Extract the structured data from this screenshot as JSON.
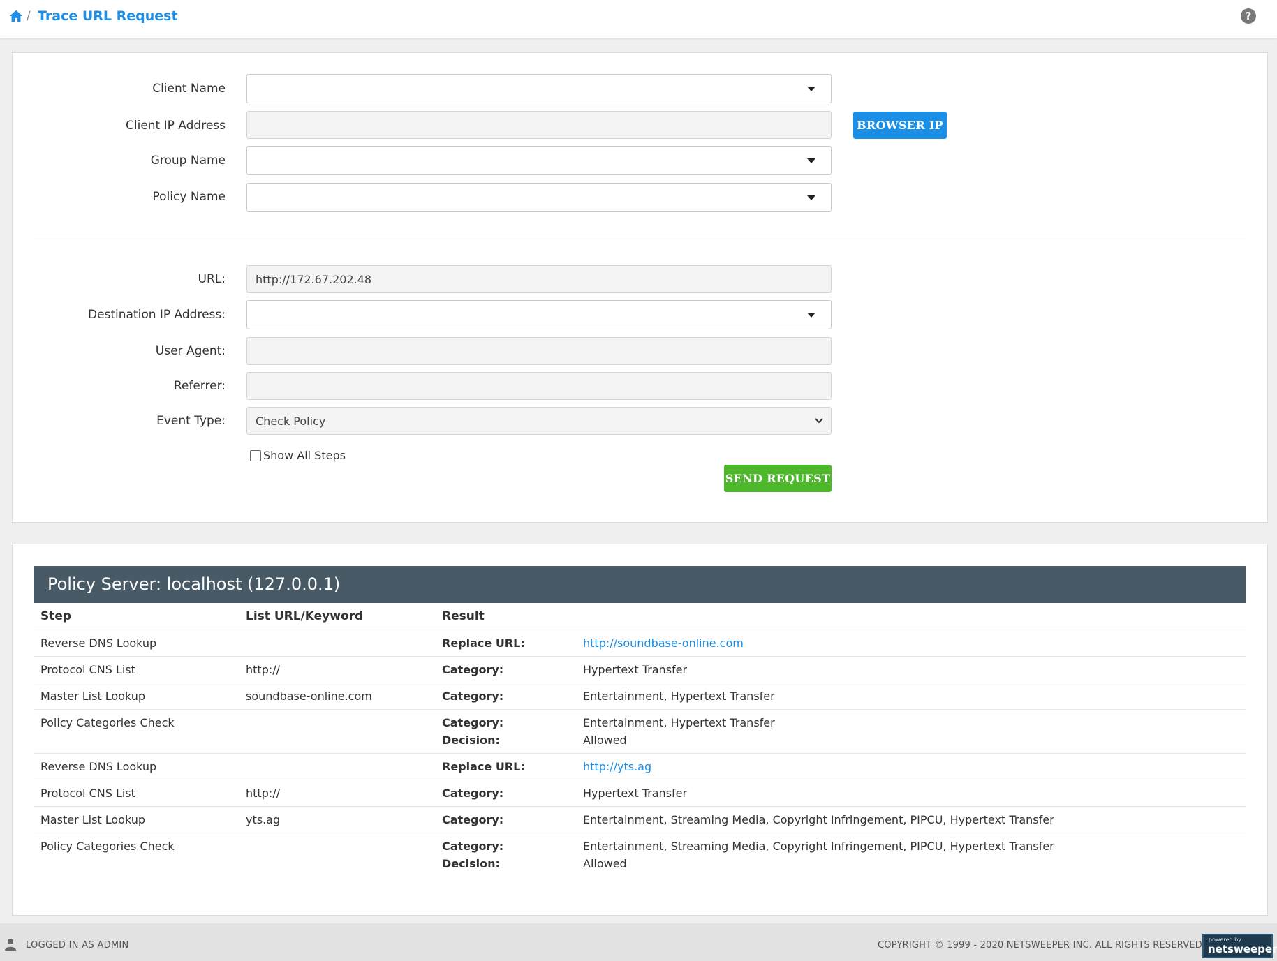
{
  "header": {
    "breadcrumb_sep": "/",
    "title": "Trace URL Request",
    "help_icon_text": "?"
  },
  "form": {
    "client_name_label": "Client Name",
    "client_ip_label": "Client IP Address",
    "group_name_label": "Group Name",
    "policy_name_label": "Policy Name",
    "browser_ip_button": "BROWSER IP",
    "url_label": "URL:",
    "url_value": "http://172.67.202.48",
    "dest_ip_label": "Destination IP Address:",
    "user_agent_label": "User Agent:",
    "referrer_label": "Referrer:",
    "event_type_label": "Event Type:",
    "event_type_value": "Check Policy",
    "show_all_steps_label": "Show All Steps",
    "send_request_button": "SEND REQUEST"
  },
  "results": {
    "policy_server_title": "Policy Server: localhost (127.0.0.1)",
    "columns": [
      "Step",
      "List URL/Keyword",
      "Result"
    ],
    "rows": [
      {
        "step": "Reverse DNS Lookup",
        "keyword": "",
        "lines": [
          {
            "key": "Replace URL:",
            "value": "http://soundbase-online.com",
            "link": true
          }
        ]
      },
      {
        "step": "Protocol CNS List",
        "keyword": "http://",
        "lines": [
          {
            "key": "Category:",
            "value": "Hypertext Transfer"
          }
        ]
      },
      {
        "step": "Master List Lookup",
        "keyword": "soundbase-online.com",
        "lines": [
          {
            "key": "Category:",
            "value": "Entertainment, Hypertext Transfer"
          }
        ]
      },
      {
        "step": "Policy Categories Check",
        "keyword": "",
        "lines": [
          {
            "key": "Category:",
            "value": "Entertainment, Hypertext Transfer"
          },
          {
            "key": "Decision:",
            "value": "Allowed"
          }
        ]
      },
      {
        "step": "Reverse DNS Lookup",
        "keyword": "",
        "lines": [
          {
            "key": "Replace URL:",
            "value": "http://yts.ag",
            "link": true
          }
        ]
      },
      {
        "step": "Protocol CNS List",
        "keyword": "http://",
        "lines": [
          {
            "key": "Category:",
            "value": "Hypertext Transfer"
          }
        ]
      },
      {
        "step": "Master List Lookup",
        "keyword": "yts.ag",
        "lines": [
          {
            "key": "Category:",
            "value": "Entertainment, Streaming Media, Copyright Infringement, PIPCU, Hypertext Transfer"
          }
        ]
      },
      {
        "step": "Policy Categories Check",
        "keyword": "",
        "lines": [
          {
            "key": "Category:",
            "value": "Entertainment, Streaming Media, Copyright Infringement, PIPCU, Hypertext Transfer"
          },
          {
            "key": "Decision:",
            "value": "Allowed"
          }
        ]
      }
    ]
  },
  "footer": {
    "logged_in": "LOGGED IN AS ADMIN",
    "copyright": "COPYRIGHT © 1999 - 2020 NETSWEEPER INC. ALL RIGHTS RESERVED.",
    "powered_small": "powered by",
    "powered_main": "netsweeper"
  },
  "colors": {
    "accent_blue": "#1b8fe6",
    "send_green": "#4cb82a",
    "server_header": "#475a66"
  }
}
